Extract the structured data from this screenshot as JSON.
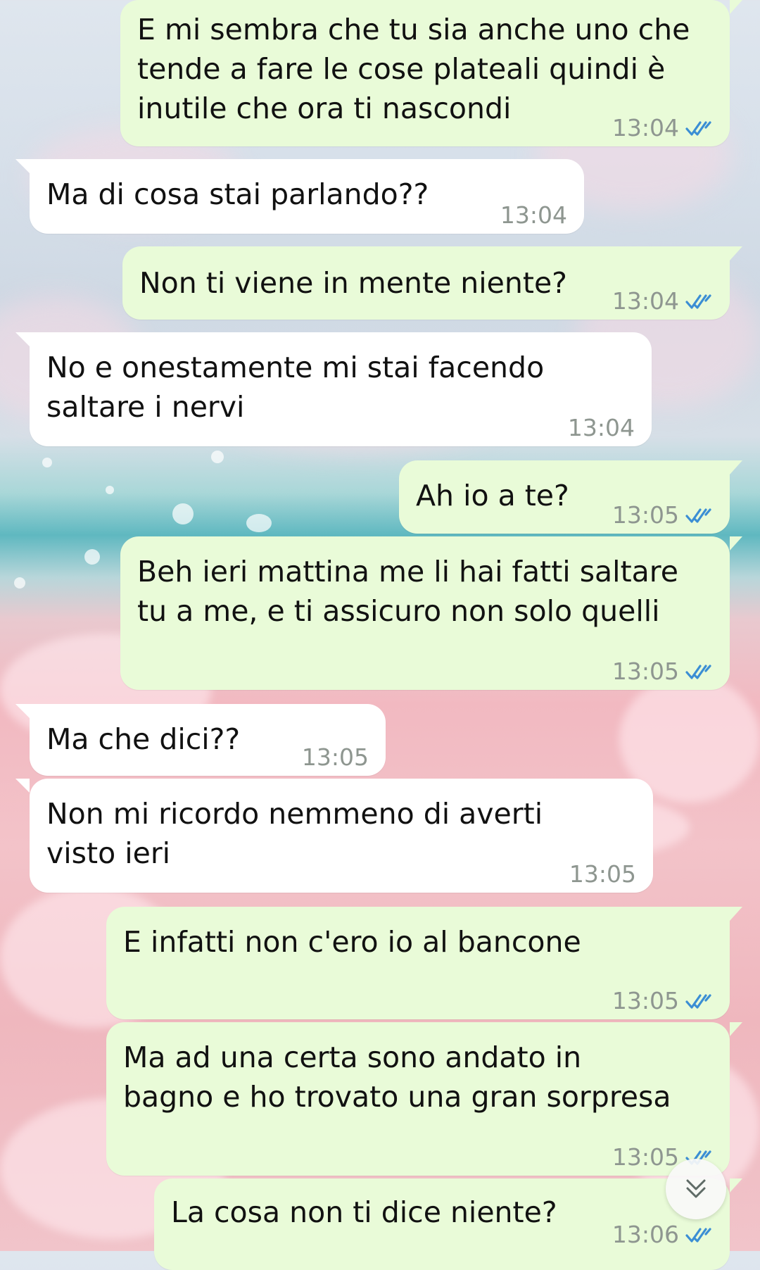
{
  "theme": {
    "outgoing_bubble": "#e9fbd8",
    "incoming_bubble": "#ffffff",
    "read_ticks": "#3b8ed4",
    "time_color": "#8e9690"
  },
  "messages": [
    {
      "direction": "outgoing",
      "text": "E mi sembra che tu sia anche uno che\ntende a fare le cose plateali quindi è\ninutile che ora ti nascondi",
      "time": "13:04",
      "status": "read"
    },
    {
      "direction": "incoming",
      "text": "Ma di cosa stai parlando??",
      "time": "13:04"
    },
    {
      "direction": "outgoing",
      "text": "Non ti viene in mente niente?",
      "time": "13:04",
      "status": "read"
    },
    {
      "direction": "incoming",
      "text": "No e onestamente mi stai facendo\nsaltare i nervi",
      "time": "13:04"
    },
    {
      "direction": "outgoing",
      "text": "Ah io a te?",
      "time": "13:05",
      "status": "read"
    },
    {
      "direction": "outgoing",
      "text": "Beh ieri mattina me li hai fatti saltare\ntu a me, e ti assicuro non solo quelli",
      "time": "13:05",
      "status": "read"
    },
    {
      "direction": "incoming",
      "text": "Ma che dici??",
      "time": "13:05"
    },
    {
      "direction": "incoming",
      "text": "Non mi ricordo nemmeno di averti\nvisto ieri",
      "time": "13:05"
    },
    {
      "direction": "outgoing",
      "text": "E infatti non c'ero io al bancone",
      "time": "13:05",
      "status": "read"
    },
    {
      "direction": "outgoing",
      "text": "Ma ad una certa sono andato in\nbagno e ho trovato una gran sorpresa",
      "time": "13:05",
      "status": "read"
    },
    {
      "direction": "outgoing",
      "text": "La cosa non ti dice niente?",
      "time": "13:06",
      "status": "read"
    }
  ],
  "scroll_button_icon": "double-chevron-down-icon"
}
